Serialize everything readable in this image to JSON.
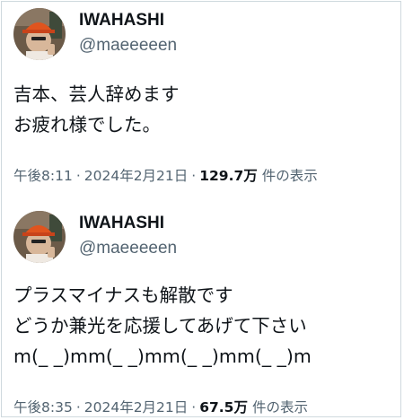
{
  "tweets": [
    {
      "display_name": "IWAHASHI",
      "handle": "@maeeeeen",
      "lines": [
        "吉本、芸人辞めます",
        "お疲れ様でした。"
      ],
      "time": "午後8:11",
      "date": "2024年2月21日",
      "views": "129.7万",
      "views_suffix": "件の表示",
      "separator": "·"
    },
    {
      "display_name": "IWAHASHI",
      "handle": "@maeeeeen",
      "lines": [
        "プラスマイナスも解散です",
        "どうか兼光を応援してあげて下さい",
        "m(_ _)mm(_ _)mm(_ _)mm(_ _)m"
      ],
      "time": "午後8:35",
      "date": "2024年2月21日",
      "views": "67.5万",
      "views_suffix": "件の表示",
      "separator": "·"
    }
  ],
  "colors": {
    "text_primary": "#0f1419",
    "text_secondary": "#536471",
    "border": "#cfd9de",
    "avatar_bg": "#6b5a48",
    "avatar_hat": "#e0541e"
  },
  "icons": [
    "avatar-photo"
  ]
}
